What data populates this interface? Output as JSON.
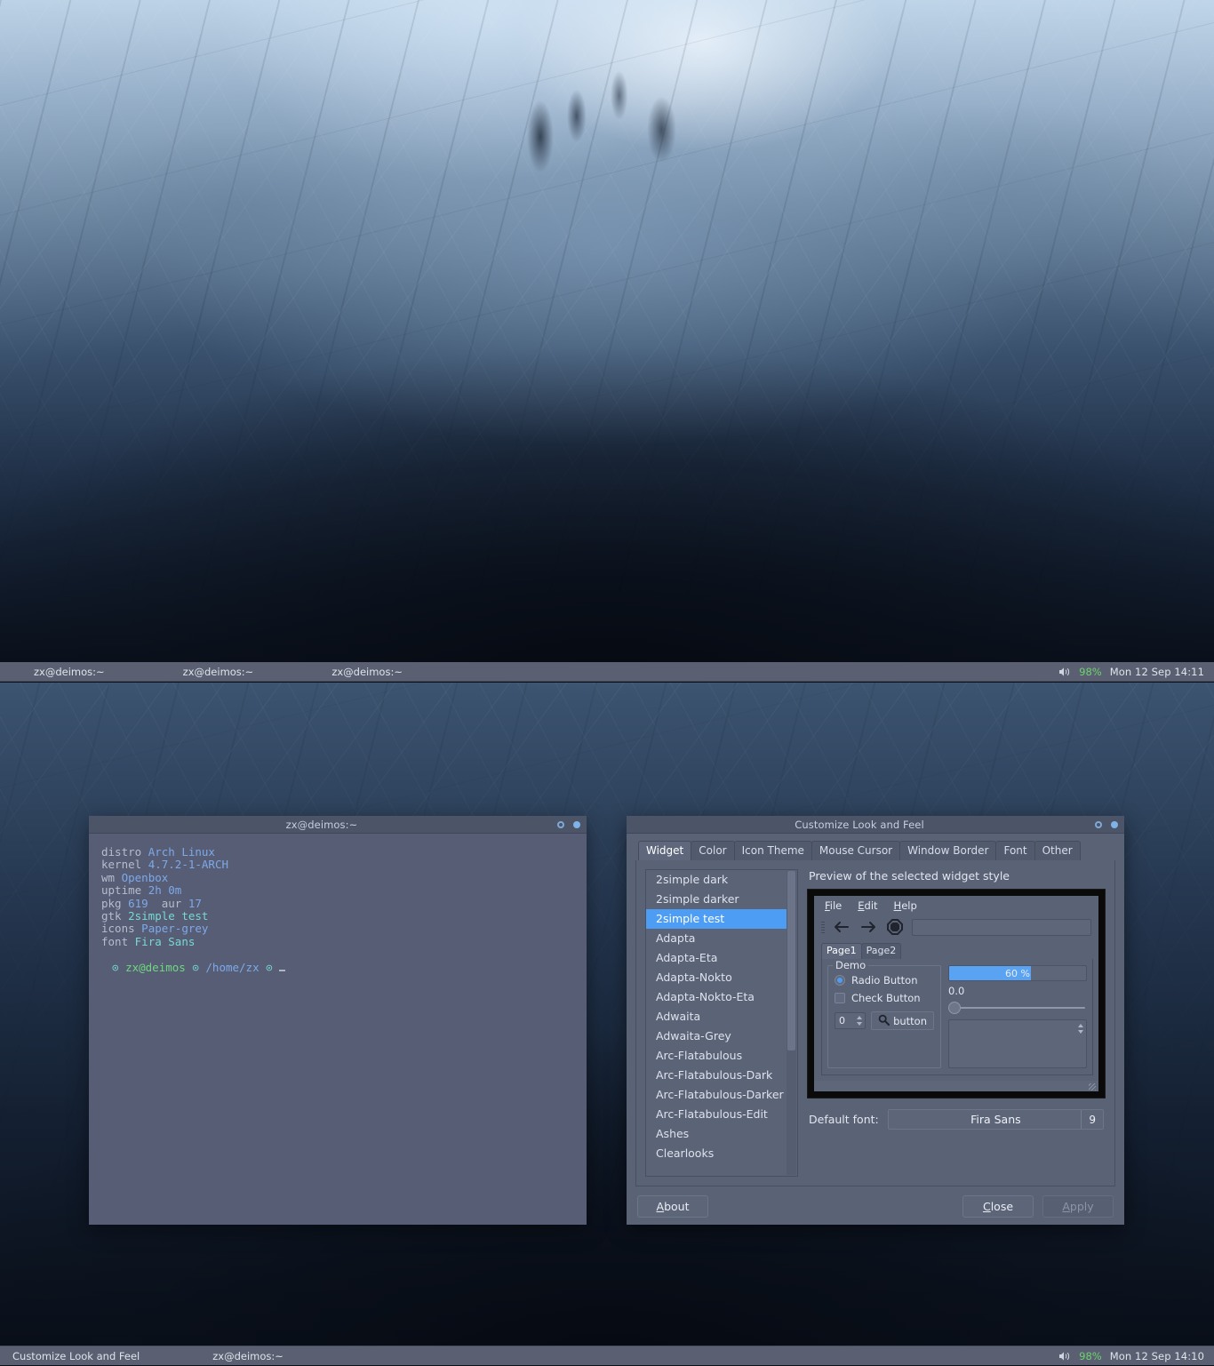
{
  "desktop": {
    "wallpaper_name": "ice-cave-photo",
    "accent_color": "#4d9df5",
    "panel_bg": "#5a6072"
  },
  "panel_top": {
    "tasks": [
      "zx@deimos:~",
      "zx@deimos:~",
      "zx@deimos:~"
    ],
    "tray": {
      "volume_icon": "speaker-icon",
      "battery": "98%",
      "clock": "Mon 12 Sep  14:11"
    }
  },
  "panel_bottom": {
    "tasks": [
      "Customize Look and Feel",
      "zx@deimos:~"
    ],
    "tray": {
      "volume_icon": "speaker-icon",
      "battery": "98%",
      "clock": "Mon 12 Sep  14:10"
    }
  },
  "terminal": {
    "title": "zx@deimos:~",
    "rows": [
      {
        "key": "distro",
        "value": "Arch Linux"
      },
      {
        "key": "kernel",
        "value": "4.7.2-1-ARCH"
      },
      {
        "key": "wm",
        "value": "Openbox"
      },
      {
        "key": "uptime",
        "value": "2h 0m"
      },
      {
        "key": "pkg",
        "value": "619",
        "key2": "aur",
        "value2": "17"
      },
      {
        "key": "gtk",
        "value": "2simple test"
      },
      {
        "key": "icons",
        "value": "Paper-grey"
      },
      {
        "key": "font",
        "value": "Fira Sans"
      }
    ],
    "prompt": {
      "sep": "⊙",
      "user": "zx@deimos",
      "path": "/home/zx"
    }
  },
  "lxappearance": {
    "title": "Customize Look and Feel",
    "tabs": [
      {
        "label": "Widget",
        "active": true
      },
      {
        "label": "Color",
        "active": false
      },
      {
        "label": "Icon Theme",
        "active": false
      },
      {
        "label": "Mouse Cursor",
        "active": false
      },
      {
        "label": "Window Border",
        "active": false
      },
      {
        "label": "Font",
        "active": false
      },
      {
        "label": "Other",
        "active": false
      }
    ],
    "theme_list": [
      {
        "label": "2simple dark",
        "selected": false
      },
      {
        "label": "2simple darker",
        "selected": false
      },
      {
        "label": "2simple test",
        "selected": true
      },
      {
        "label": "Adapta",
        "selected": false
      },
      {
        "label": "Adapta-Eta",
        "selected": false
      },
      {
        "label": "Adapta-Nokto",
        "selected": false
      },
      {
        "label": "Adapta-Nokto-Eta",
        "selected": false
      },
      {
        "label": "Adwaita",
        "selected": false
      },
      {
        "label": "Adwaita-Grey",
        "selected": false
      },
      {
        "label": "Arc-Flatabulous",
        "selected": false
      },
      {
        "label": "Arc-Flatabulous-Dark",
        "selected": false
      },
      {
        "label": "Arc-Flatabulous-Darker",
        "selected": false
      },
      {
        "label": "Arc-Flatabulous-Edit",
        "selected": false
      },
      {
        "label": "Ashes",
        "selected": false
      },
      {
        "label": "Clearlooks",
        "selected": false
      }
    ],
    "preview": {
      "label": "Preview of the selected widget style",
      "menus": [
        {
          "pre": "",
          "accel": "F",
          "post": "ile"
        },
        {
          "pre": "",
          "accel": "E",
          "post": "dit"
        },
        {
          "pre": "",
          "accel": "H",
          "post": "elp"
        }
      ],
      "toolbar_icons": [
        "back-arrow-icon",
        "forward-arrow-icon",
        "stop-icon"
      ],
      "entry_value": "",
      "pages": [
        {
          "label": "Page1",
          "accel": "g",
          "active": true
        },
        {
          "label": "Page2",
          "accel": "g",
          "active": false
        }
      ],
      "demo": {
        "legend": "Demo",
        "radio_label": "Radio Button",
        "radio_checked": true,
        "check_label": "Check Button",
        "check_checked": false,
        "spin_value": "0",
        "button_label": "button",
        "button_icon": "search-icon"
      },
      "progress_text": "60 %",
      "progress_percent": 60,
      "scale_value": "0.0",
      "scale_percent": 0
    },
    "default_font": {
      "label": "Default font:",
      "family": "Fira Sans",
      "size": "9"
    },
    "buttons": {
      "about": {
        "pre": "",
        "accel": "A",
        "post": "bout",
        "disabled": false
      },
      "close": {
        "pre": "",
        "accel": "C",
        "post": "lose",
        "disabled": false
      },
      "apply": {
        "pre": "",
        "accel": "A",
        "post": "pply",
        "disabled": true
      }
    }
  }
}
